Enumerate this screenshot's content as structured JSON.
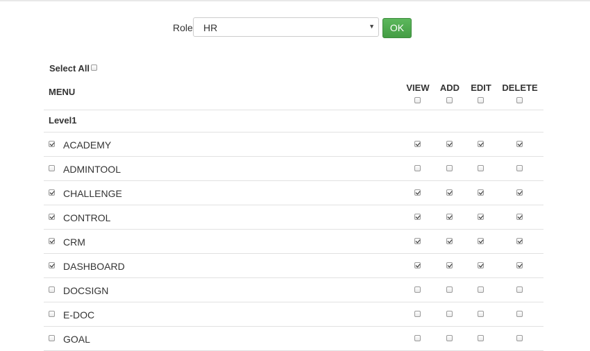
{
  "role": {
    "label": "Role",
    "selected": "HR",
    "ok_label": "OK"
  },
  "select_all": {
    "label": "Select All",
    "checked": false
  },
  "table": {
    "menu_header": "MENU",
    "columns": [
      "VIEW",
      "ADD",
      "EDIT",
      "DELETE"
    ],
    "level_label": "Level1",
    "rows": [
      {
        "name": "ACADEMY",
        "checked": true
      },
      {
        "name": "ADMINTOOL",
        "checked": false
      },
      {
        "name": "CHALLENGE",
        "checked": true
      },
      {
        "name": "CONTROL",
        "checked": true
      },
      {
        "name": "CRM",
        "checked": true
      },
      {
        "name": "DASHBOARD",
        "checked": true
      },
      {
        "name": "DOCSIGN",
        "checked": false
      },
      {
        "name": "E-DOC",
        "checked": false
      },
      {
        "name": "GOAL",
        "checked": false
      }
    ]
  },
  "colors": {
    "ok_button": "#4cae4c",
    "divider": "#e1e1e1"
  }
}
